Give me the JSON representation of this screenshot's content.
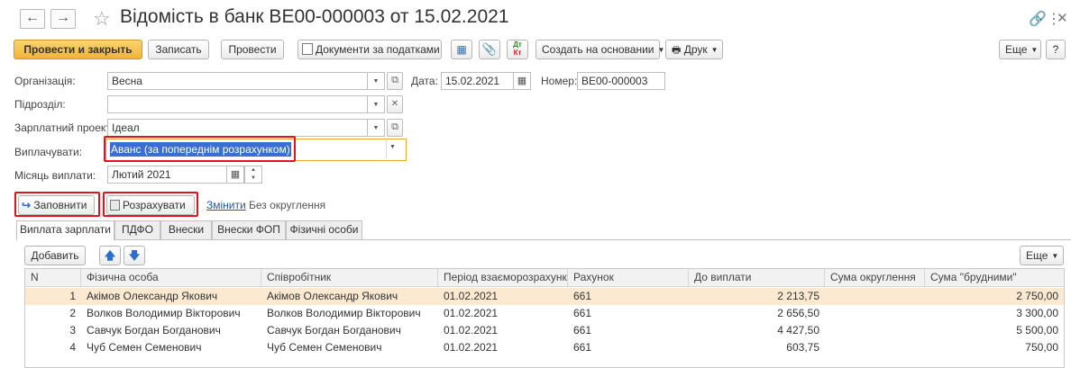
{
  "header": {
    "title": "Відомість в банк ВЕ00-000003 от 15.02.2021",
    "back_icon": "arrow-left-icon",
    "forward_icon": "arrow-right-icon",
    "favorite_icon": "star-icon",
    "link_icon": "link-icon",
    "more_icon": "more-vert-icon",
    "close_icon": "close-icon"
  },
  "toolbar": {
    "post_close_label": "Провести и закрыть",
    "write_label": "Записать",
    "post_label": "Провести",
    "tax_docs_label": "Документи за податками",
    "create_based_label": "Создать на основании",
    "print_label": "Друк",
    "more_label": "Еще",
    "help_label": "?"
  },
  "form": {
    "org_label": "Організація:",
    "org_value": "Весна",
    "date_label": "Дата:",
    "date_value": "15.02.2021",
    "number_label": "Номер:",
    "number_value": "ВЕ00-000003",
    "division_label": "Підрозділ:",
    "division_value": "",
    "project_label": "Зарплатний проект:",
    "project_value": "Ідеал",
    "pay_label": "Виплачувати:",
    "pay_value": "Аванс (за попереднім розрахунком)",
    "month_label": "Місяць виплати:",
    "month_value": "Лютий 2021"
  },
  "actions": {
    "fill_label": "Заповнити",
    "calc_label": "Розрахувати",
    "change_label": "Змінити",
    "rounding_label": "Без округлення"
  },
  "tabs": [
    "Виплата зарплати",
    "ПДФО",
    "Внески",
    "Внески ФОП",
    "Фізичні особи"
  ],
  "table_toolbar": {
    "add_label": "Добавить",
    "more_label": "Еще"
  },
  "table": {
    "columns": [
      "N",
      "Фізична особа",
      "Співробітник",
      "Період взаєморозрахунків",
      "Рахунок",
      "До виплати",
      "Сума округлення",
      "Сума \"брудними\""
    ],
    "rows": [
      [
        "1",
        "Акімов Олександр Якович",
        "Акімов Олександр Якович",
        "01.02.2021",
        "661",
        "2 213,75",
        "",
        "2 750,00"
      ],
      [
        "2",
        "Волков Володимир Вікторович",
        "Волков Володимир Вікторович",
        "01.02.2021",
        "661",
        "2 656,50",
        "",
        "3 300,00"
      ],
      [
        "3",
        "Савчук Богдан Богданович",
        "Савчук Богдан Богданович",
        "01.02.2021",
        "661",
        "4 427,50",
        "",
        "5 500,00"
      ],
      [
        "4",
        "Чуб Семен Семенович",
        "Чуб Семен Семенович",
        "01.02.2021",
        "661",
        "603,75",
        "",
        "750,00"
      ]
    ]
  },
  "colors": {
    "primary_button": "#f0b43a",
    "highlight_box": "#e0141e",
    "selected_row": "#fbe9d1",
    "link": "#2255a4",
    "selection_bg": "#3a6fd0"
  }
}
